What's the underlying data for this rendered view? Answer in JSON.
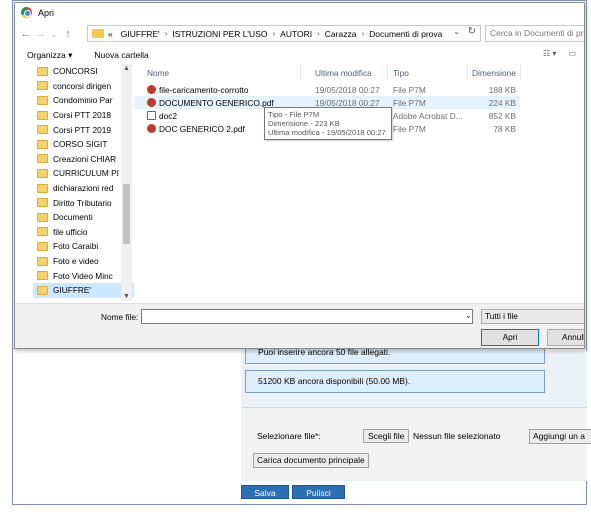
{
  "dialog": {
    "title": "Apri",
    "address": {
      "crumbs": [
        "GIUFFRE'",
        "ISTRUZIONI PER L'USO",
        "AUTORI",
        "Carazza",
        "Documenti di prova"
      ],
      "overflow": "«"
    },
    "search_placeholder": "Cerca in Documenti di prova",
    "toolbar": {
      "organize": "Organizza ▾",
      "new_folder": "Nuova cartella"
    },
    "tree": [
      "CONCORSI",
      "concorsi dirigen",
      "Condominio Par",
      "Corsi PTT 2018",
      "Corsi PTT 2019",
      "CORSO SIGIT",
      "Creazioni CHIAR",
      "CURRICULUM PI",
      "dichiarazioni red",
      "Diritto Tributario",
      "Documenti",
      "file ufficio",
      "Foto Caraibi",
      "Foto e video",
      "Foto Video Minc",
      "GIUFFRE'"
    ],
    "tree_selected": "GIUFFRE'",
    "columns": {
      "name": "Nome",
      "modified": "Ultima modifica",
      "type": "Tipo",
      "size": "Dimensione"
    },
    "files": [
      {
        "name": "file-caricamento-corrotto",
        "modified": "19/05/2018 00:27",
        "type": "File P7M",
        "size": "188 KB",
        "icon": "p7m-icon"
      },
      {
        "name": "DOCUMENTO GENERICO.pdf",
        "modified": "19/05/2018 00:27",
        "type": "File P7M",
        "size": "224 KB",
        "icon": "p7m-icon"
      },
      {
        "name": "doc2",
        "modified": "",
        "type": "Adobe Acrobat D...",
        "size": "852 KB",
        "icon": "pdf-icon"
      },
      {
        "name": "DOC GENERICO 2.pdf",
        "modified": "",
        "type": "File P7M",
        "size": "78 KB",
        "icon": "p7m-icon"
      }
    ],
    "tooltip": {
      "line1": "Tipo - File P7M",
      "line2": "Dimensione - 223 KB",
      "line3": "Ultima modifica - 19/05/2018 00:27"
    },
    "filename_label": "Nome file:",
    "filename_value": "",
    "filter": "Tutti i file",
    "open_button": "Apri",
    "cancel_button": "Annulla"
  },
  "page": {
    "info1": "Puoi inserire ancora 50 file allegati.",
    "info2": "51200 KB ancora disponibili (50.00 MB).",
    "select_label": "Selezionare file*:",
    "choose_button": "Scegli file",
    "no_file": "Nessun file selezionato",
    "add_button": "Aggiungi un a",
    "upload_main_button": "Carica documento principale",
    "save_button": "Salva",
    "clear_button": "Pulisci"
  }
}
